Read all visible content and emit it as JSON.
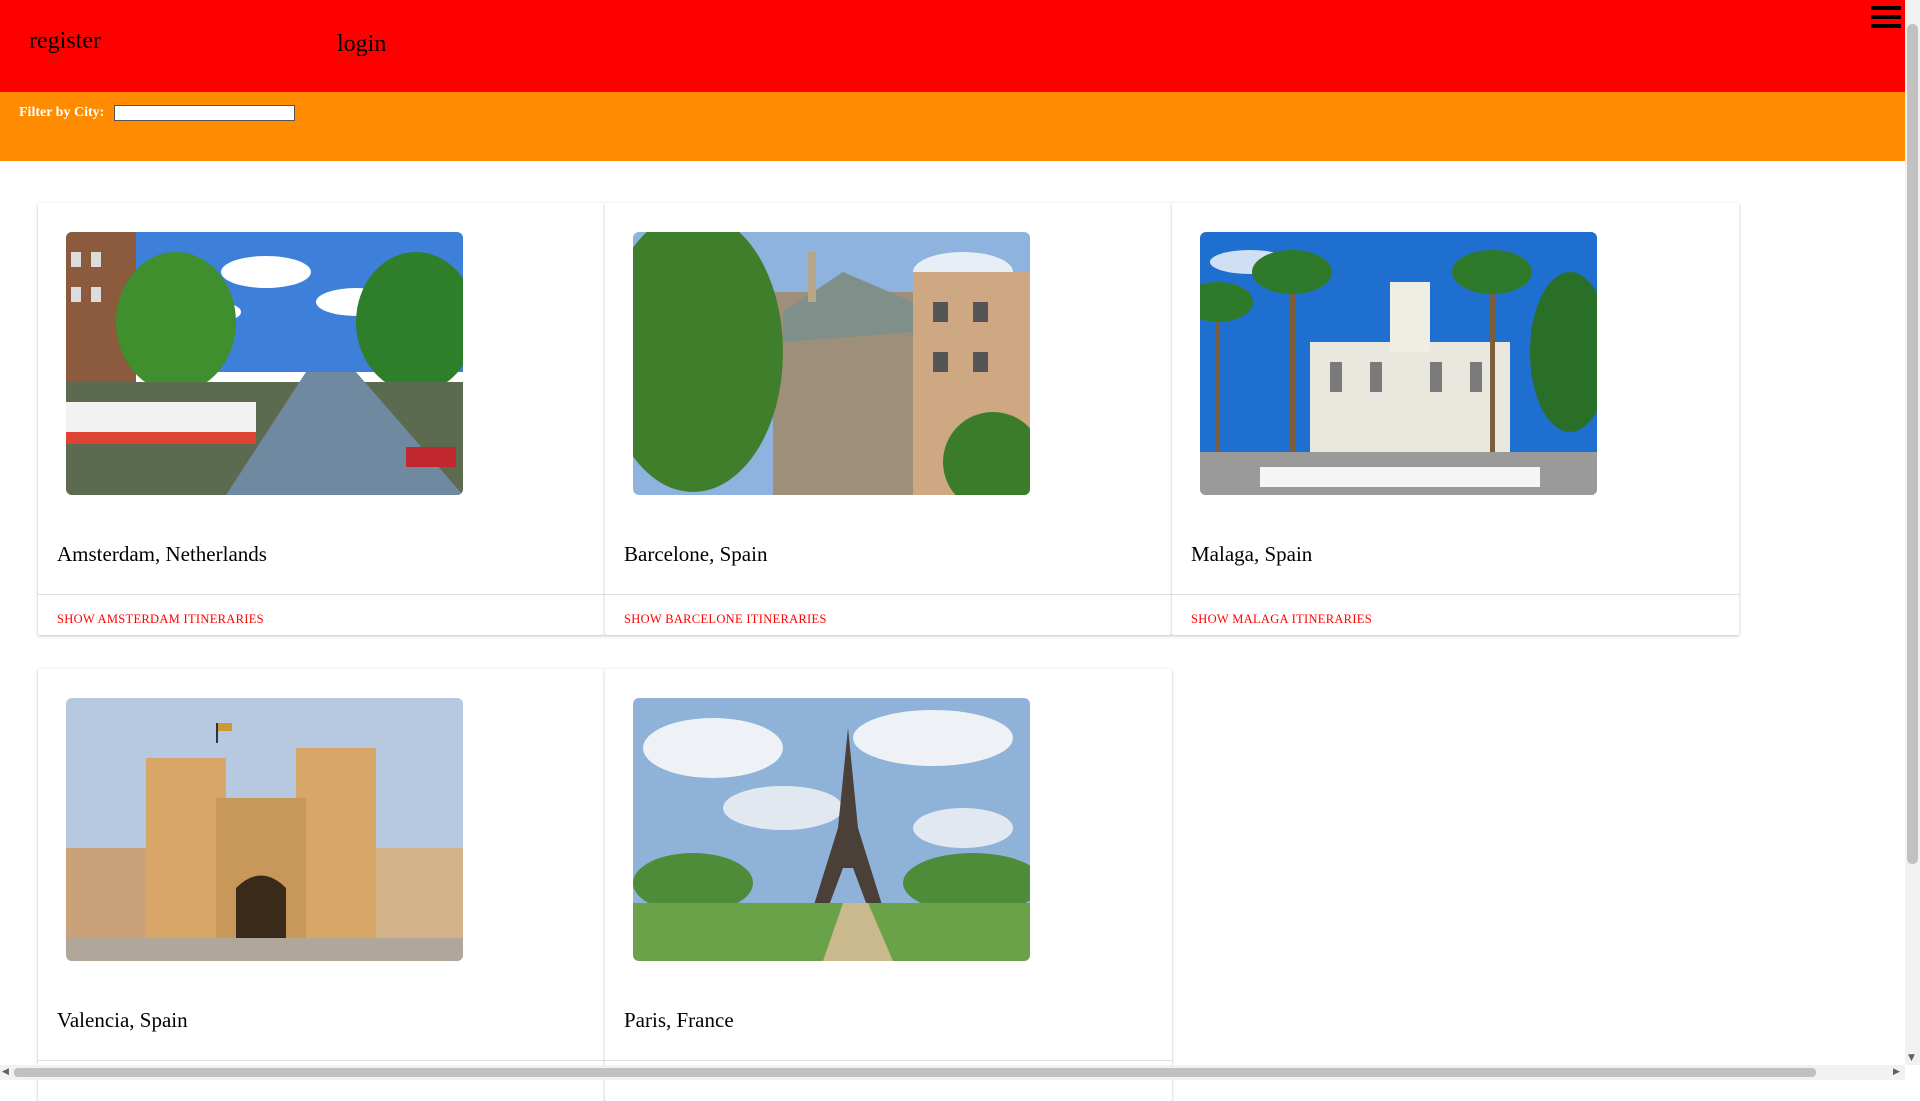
{
  "header": {
    "register_label": "register",
    "login_label": "login",
    "menu_icon": "hamburger-menu-icon",
    "bg_color": "#ff0000"
  },
  "filter": {
    "label": "Filter by City:",
    "value": "",
    "placeholder": "",
    "bg_color": "#ff8c00"
  },
  "cities": [
    {
      "title": "Amsterdam, Netherlands",
      "action": "SHOW AMSTERDAM ITINERARIES",
      "image": "amsterdam-canal-photo"
    },
    {
      "title": "Barcelone, Spain",
      "action": "SHOW BARCELONE ITINERARIES",
      "image": "casa-batllo-photo"
    },
    {
      "title": "Malaga, Spain",
      "action": "SHOW MALAGA ITINERARIES",
      "image": "malaga-city-hall-photo"
    },
    {
      "title": "Valencia, Spain",
      "action": "",
      "image": "torres-de-serranos-photo"
    },
    {
      "title": "Paris, France",
      "action": "",
      "image": "eiffel-tower-photo"
    }
  ],
  "colors": {
    "accent": "#ff0000"
  }
}
